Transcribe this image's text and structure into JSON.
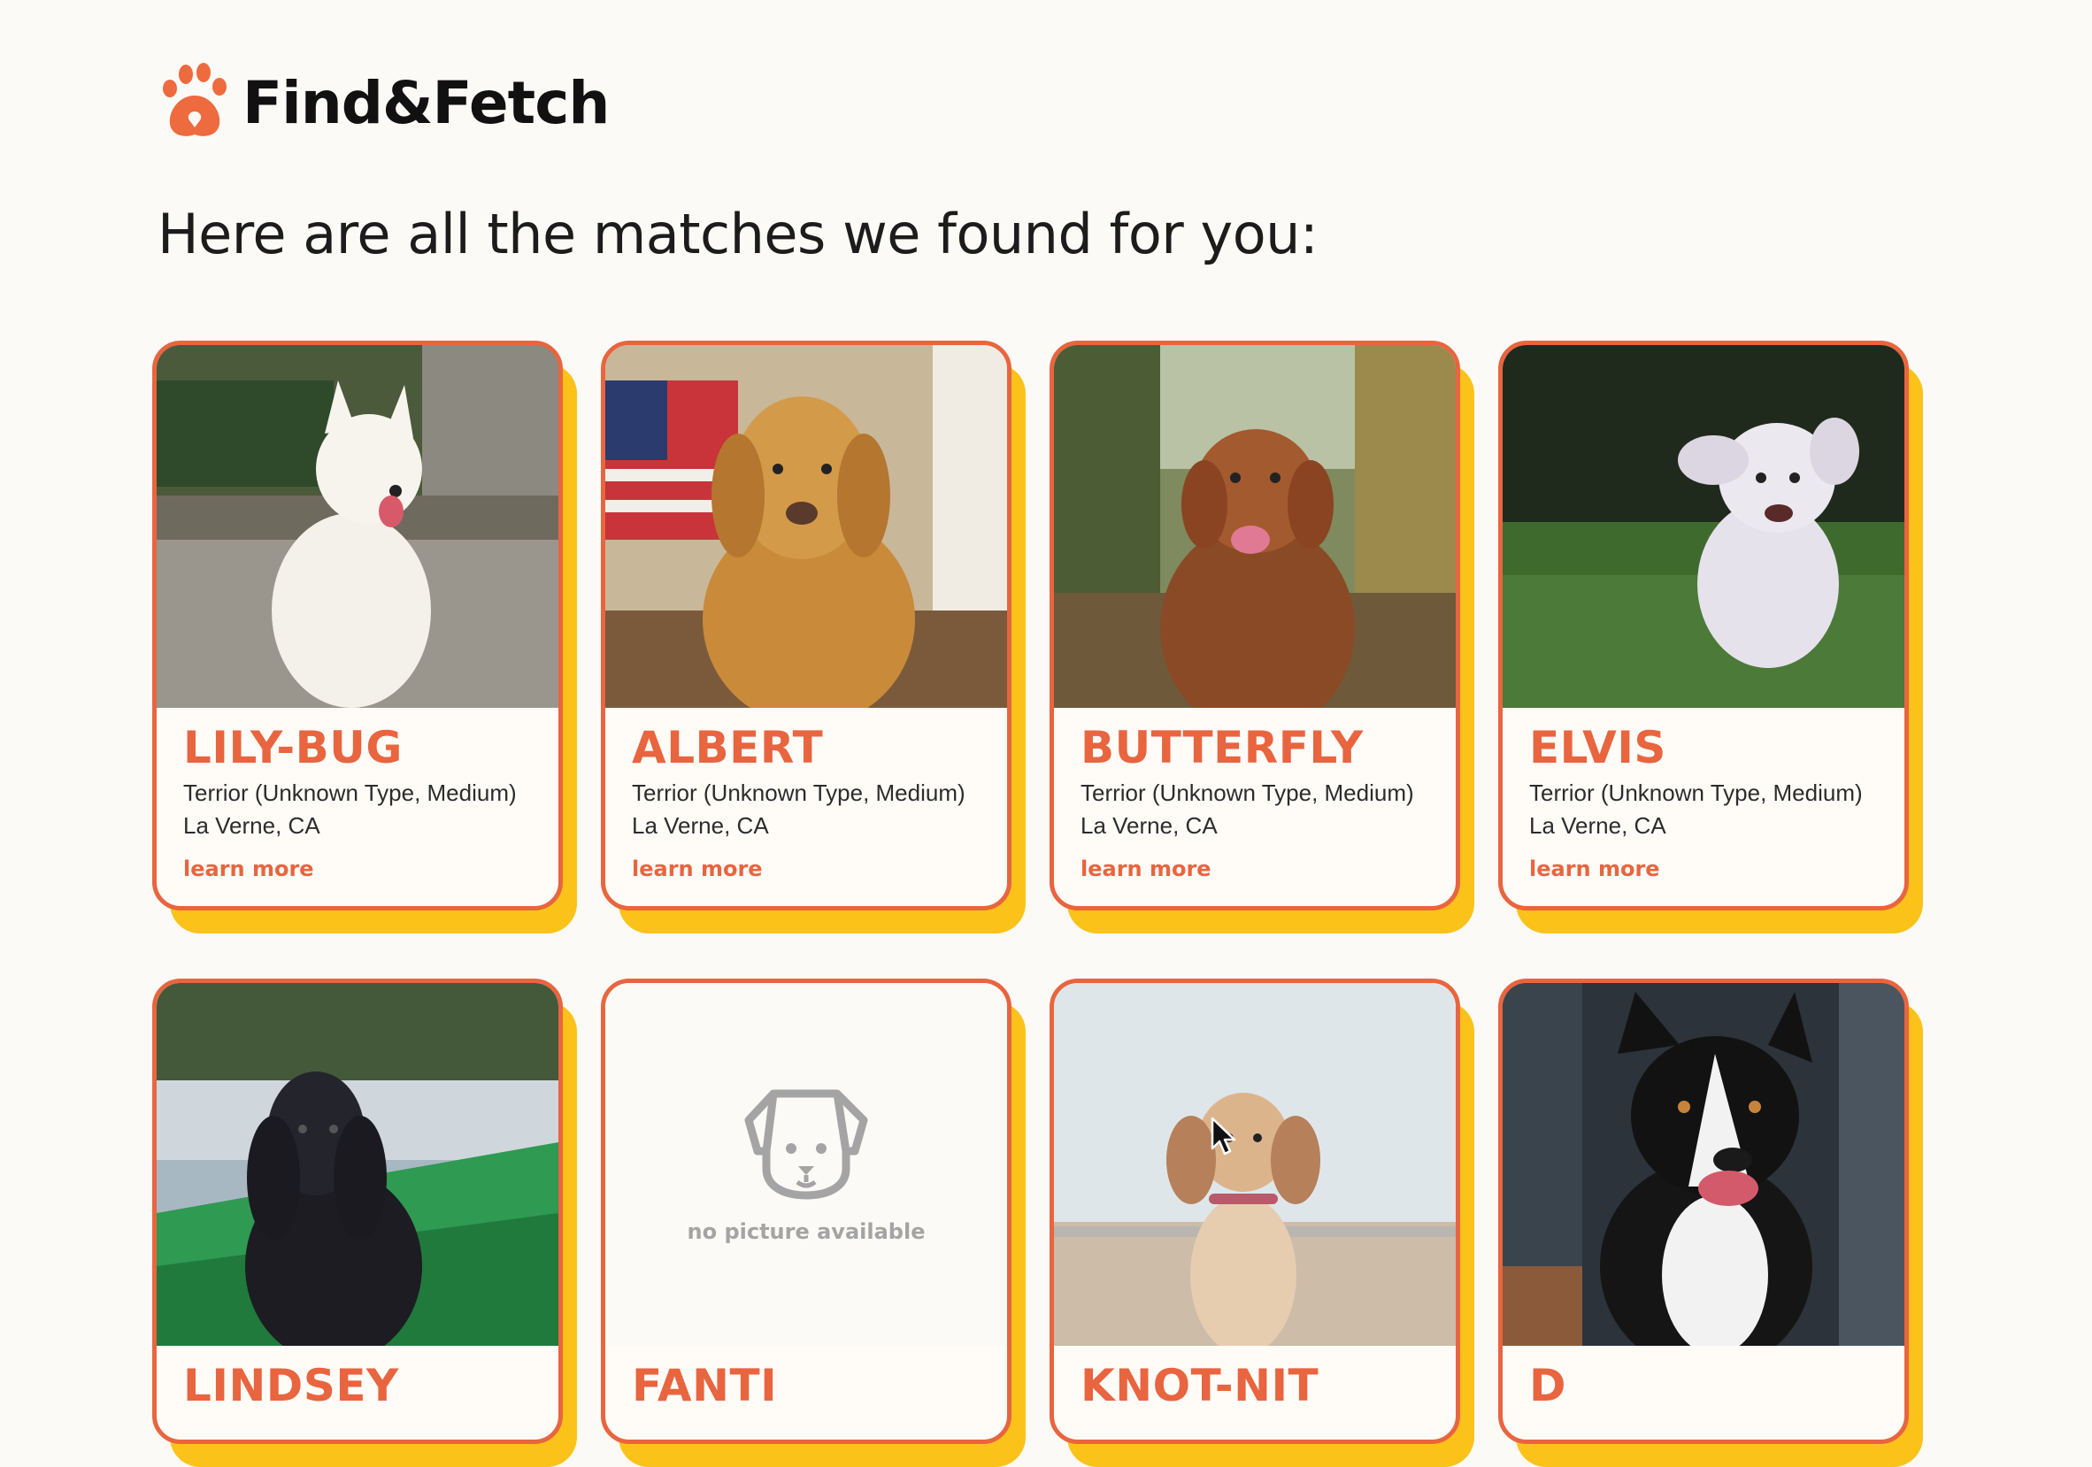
{
  "brand": {
    "name": "Find&Fetch",
    "accent": "#e8653f",
    "shadow": "#fbc21a"
  },
  "headline": "Here are all the matches we found for you:",
  "cards": [
    {
      "name": "LILY-BUG",
      "breed": "Terrior (Unknown Type, Medium)",
      "location": "La Verne, CA",
      "link": "learn more"
    },
    {
      "name": "ALBERT",
      "breed": "Terrior (Unknown Type, Medium)",
      "location": "La Verne, CA",
      "link": "learn more"
    },
    {
      "name": "BUTTERFLY",
      "breed": "Terrior (Unknown Type, Medium)",
      "location": "La Verne, CA",
      "link": "learn more"
    },
    {
      "name": "ELVIS",
      "breed": "Terrior (Unknown Type, Medium)",
      "location": "La Verne, CA",
      "link": "learn more"
    },
    {
      "name": "LINDSEY"
    },
    {
      "name": "FANTI",
      "no_picture_label": "no picture available"
    },
    {
      "name": "KNOT-NIT"
    },
    {
      "name": "D"
    }
  ]
}
